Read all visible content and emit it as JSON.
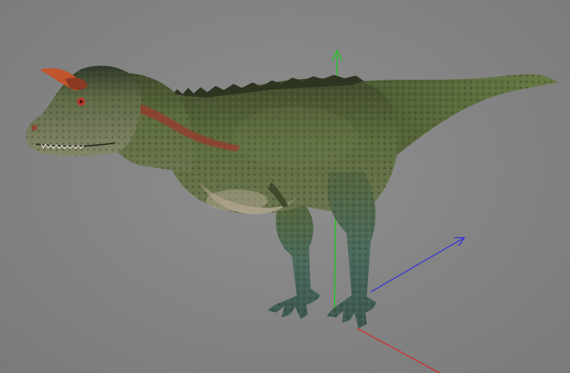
{
  "viewport": {
    "background_color": "#858585",
    "model": "carnotaurus-dinosaur-3d-model",
    "gizmo": {
      "y_axis_color": "#22c422",
      "x_axis_color": "#3434d6",
      "z_axis_color": "#d42a2a"
    },
    "model_colors": {
      "skin_main": "#5b6b3c",
      "skin_dark": "#36412a",
      "belly": "#a69a86",
      "stripe": "#9a3a2c",
      "horn": "#c0552e",
      "legs": "#4e6a62"
    }
  }
}
